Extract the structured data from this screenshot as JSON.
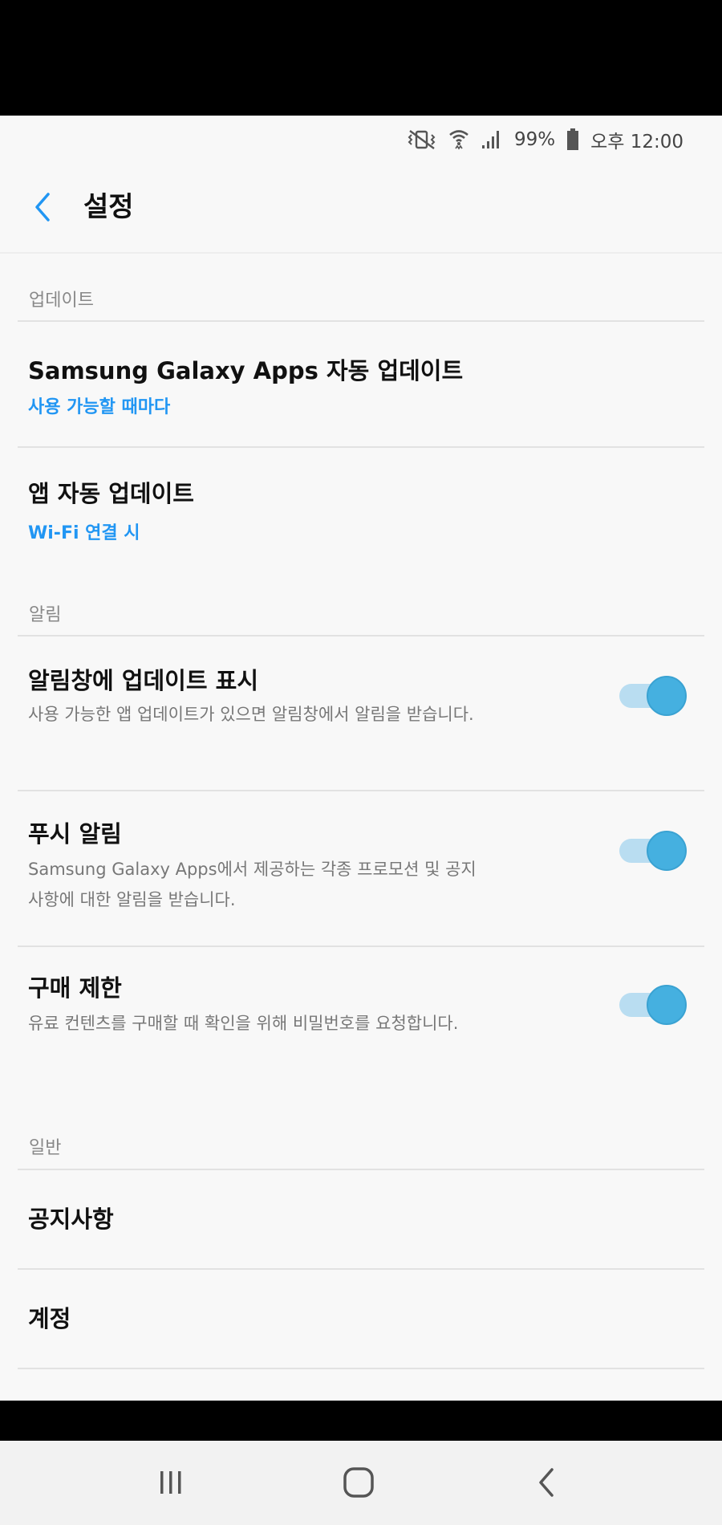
{
  "status_bar": {
    "battery": "99%",
    "time": "오후 12:00",
    "icons": [
      "vibrate-mute-icon",
      "wifi-icon",
      "signal-icon",
      "battery-icon"
    ]
  },
  "app_bar": {
    "title": "설정",
    "back_icon": "chevron-left-icon"
  },
  "sections": {
    "update": {
      "header": "업데이트",
      "items": [
        {
          "title": "Samsung Galaxy Apps 자동 업데이트",
          "subtitle": "사용 가능할 때마다"
        },
        {
          "title": "앱 자동 업데이트",
          "subtitle": "Wi-Fi 연결 시"
        }
      ]
    },
    "notification": {
      "header": "알림",
      "items": [
        {
          "title": "알림창에 업데이트 표시",
          "description": "사용 가능한 앱 업데이트가 있으면 알림창에서 알림을 받습니다.",
          "enabled": true
        },
        {
          "title": "푸시 알림",
          "description": "Samsung Galaxy Apps에서 제공하는 각종 프로모션 및 공지사항에 대한 알림을 받습니다.",
          "enabled": true
        },
        {
          "title": "구매 제한",
          "description": "유료 컨텐츠를 구매할 때 확인을 위해 비밀번호를 요청합니다.",
          "enabled": true
        }
      ]
    },
    "general": {
      "header": "일반",
      "items": [
        {
          "title": "공지사항"
        },
        {
          "title": "계정"
        }
      ]
    }
  },
  "nav_bar": {
    "icons": [
      "recent-apps-icon",
      "home-icon",
      "back-icon"
    ]
  },
  "colors": {
    "accent": "#2196f3",
    "toggle_track": "#b9ddf1",
    "toggle_thumb": "#45b0e0",
    "background": "#f8f8f8"
  }
}
